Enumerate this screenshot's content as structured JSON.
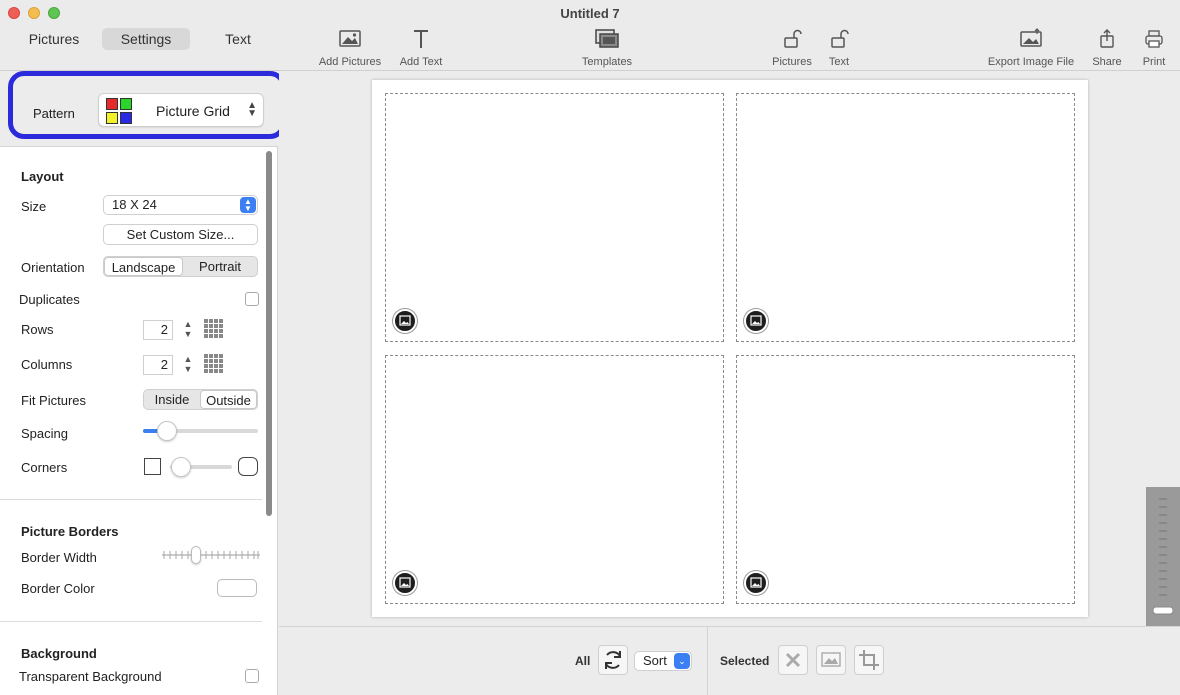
{
  "window": {
    "title": "Untitled 7"
  },
  "tabs": [
    {
      "label": "Pictures"
    },
    {
      "label": "Settings",
      "active": true
    },
    {
      "label": "Text"
    }
  ],
  "toolbar": {
    "add_pictures": "Add Pictures",
    "add_text": "Add Text",
    "templates": "Templates",
    "lock_pictures": "Pictures",
    "lock_text": "Text",
    "export": "Export Image File",
    "share": "Share",
    "print": "Print"
  },
  "pattern": {
    "label": "Pattern",
    "value": "Picture Grid",
    "swatch_colors": [
      "#e52a2a",
      "#2ad42a",
      "#f2f22a",
      "#2a2ae5"
    ]
  },
  "layout": {
    "title": "Layout",
    "size_label": "Size",
    "size_value": "18 X 24",
    "custom_size_button": "Set Custom Size...",
    "orientation_label": "Orientation",
    "orientation_options": [
      "Landscape",
      "Portrait"
    ],
    "orientation_selected": "Landscape",
    "duplicates_label": "Duplicates",
    "duplicates_checked": false,
    "rows_label": "Rows",
    "rows_value": "2",
    "columns_label": "Columns",
    "columns_value": "2",
    "fit_label": "Fit Pictures",
    "fit_options": [
      "Inside",
      "Outside"
    ],
    "fit_selected": "Outside",
    "spacing_label": "Spacing",
    "spacing_level": 0.2,
    "corners_label": "Corners",
    "corners_level": 0.0
  },
  "borders": {
    "title": "Picture Borders",
    "width_label": "Border Width",
    "width_level": 0.33,
    "color_label": "Border Color",
    "color_value": "#ffffff"
  },
  "background": {
    "title": "Background",
    "transparent_label": "Transparent Background",
    "transparent_checked": false
  },
  "bottom": {
    "all_label": "All",
    "sort_label": "Sort",
    "selected_label": "Selected"
  },
  "colors": {
    "accent": "#3b7ff2",
    "highlight_border": "#2b2bdb"
  }
}
